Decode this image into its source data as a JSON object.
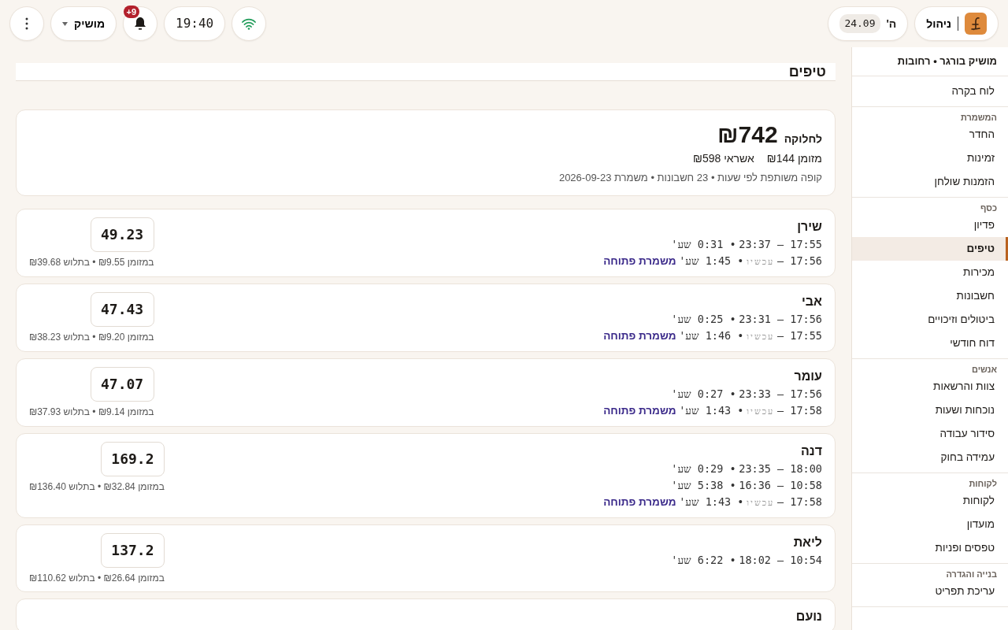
{
  "topbar": {
    "brand": {
      "label": "ניהול"
    },
    "date": {
      "day": "ה'",
      "date": "24.09"
    },
    "wifi": {
      "connected": true
    },
    "time": "19:40",
    "notifications": {
      "badge": "+9"
    },
    "user": {
      "name": "מושיק"
    }
  },
  "sidebar": {
    "title": "מושיק בורגר • רחובות",
    "sections": [
      {
        "items": [
          {
            "label": "לוח בקרה",
            "selected": false
          }
        ]
      },
      {
        "title": "המשמרת",
        "items": [
          {
            "label": "החדר",
            "selected": false
          },
          {
            "label": "זמינות",
            "selected": false
          },
          {
            "label": "הזמנות שולחן",
            "selected": false
          }
        ]
      },
      {
        "title": "כסף",
        "items": [
          {
            "label": "פדיון",
            "selected": false
          },
          {
            "label": "טיפים",
            "selected": true
          },
          {
            "label": "מכירות",
            "selected": false
          },
          {
            "label": "חשבונות",
            "selected": false
          },
          {
            "label": "ביטולים וזיכויים",
            "selected": false
          },
          {
            "label": "דוח חודשי",
            "selected": false
          }
        ]
      },
      {
        "title": "אנשים",
        "items": [
          {
            "label": "צוות והרשאות",
            "selected": false
          },
          {
            "label": "נוכחות ושעות",
            "selected": false
          },
          {
            "label": "סידור עבודה",
            "selected": false
          },
          {
            "label": "עמידה בחוק",
            "selected": false
          }
        ]
      },
      {
        "title": "לקוחות",
        "items": [
          {
            "label": "לקוחות",
            "selected": false
          },
          {
            "label": "מועדון",
            "selected": false
          },
          {
            "label": "טפסים ופניות",
            "selected": false
          }
        ]
      },
      {
        "title": "בנייה והגדרה",
        "items": [
          {
            "label": "עריכת תפריט",
            "selected": false
          }
        ]
      }
    ]
  },
  "page": {
    "title": "טיפים"
  },
  "summary": {
    "label": "לחלוקה",
    "total": "₪742",
    "cash": "מזומן ₪144",
    "credit": "אשראי ₪598",
    "note": "קופה משותפת לפי שעות • 23 חשבונות • משמרת 2026-09-23"
  },
  "employees": [
    {
      "name": "שירן",
      "amount": "49.23",
      "breakdown": "במזומן ₪9.55 • בתלוש ₪39.68",
      "shifts": [
        {
          "range": "17:55 – 23:37",
          "duration": "• 0:31 שע'",
          "open": false
        },
        {
          "range": "17:56 –",
          "now": "עכשיו",
          "duration": "• 1:45 שע'",
          "open": true,
          "open_label": "משמרת פתוחה"
        }
      ]
    },
    {
      "name": "אבי",
      "amount": "47.43",
      "breakdown": "במזומן ₪9.20 • בתלוש ₪38.23",
      "shifts": [
        {
          "range": "17:56 – 23:31",
          "duration": "• 0:25 שע'",
          "open": false
        },
        {
          "range": "17:55 –",
          "now": "עכשיו",
          "duration": "• 1:46 שע'",
          "open": true,
          "open_label": "משמרת פתוחה"
        }
      ]
    },
    {
      "name": "עומר",
      "amount": "47.07",
      "breakdown": "במזומן ₪9.14 • בתלוש ₪37.93",
      "shifts": [
        {
          "range": "17:56 – 23:33",
          "duration": "• 0:27 שע'",
          "open": false
        },
        {
          "range": "17:58 –",
          "now": "עכשיו",
          "duration": "• 1:43 שע'",
          "open": true,
          "open_label": "משמרת פתוחה"
        }
      ]
    },
    {
      "name": "דנה",
      "amount": "169.2",
      "breakdown": "במזומן ₪32.84 • בתלוש ₪136.40",
      "shifts": [
        {
          "range": "18:00 – 23:35",
          "duration": "• 0:29 שע'",
          "open": false
        },
        {
          "range": "10:58 – 16:36",
          "duration": "• 5:38 שע'",
          "open": false
        },
        {
          "range": "17:58 –",
          "now": "עכשיו",
          "duration": "• 1:43 שע'",
          "open": true,
          "open_label": "משמרת פתוחה"
        }
      ]
    },
    {
      "name": "ליאת",
      "amount": "137.2",
      "breakdown": "במזומן ₪26.64 • בתלוש ₪110.62",
      "shifts": [
        {
          "range": "10:54 – 18:02",
          "duration": "• 6:22 שע'",
          "open": false
        }
      ]
    },
    {
      "name": "נועם"
    }
  ]
}
